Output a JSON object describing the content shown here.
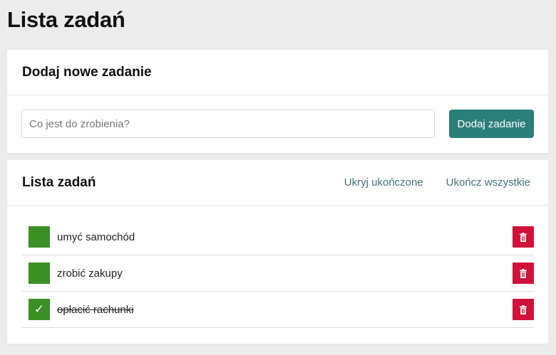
{
  "page": {
    "title": "Lista zadań"
  },
  "add_section": {
    "heading": "Dodaj nowe zadanie",
    "input_placeholder": "Co jest do zrobienia?",
    "input_value": "",
    "button_label": "Dodaj zadanie"
  },
  "list_section": {
    "heading": "Lista zadań",
    "hide_completed_label": "Ukryj ukończone",
    "complete_all_label": "Ukończ wszystkie",
    "tasks": [
      {
        "text": "umyć samochód",
        "completed": false,
        "check_glyph": ""
      },
      {
        "text": "zrobić zakupy",
        "completed": false,
        "check_glyph": ""
      },
      {
        "text": "opłacić rachunki",
        "completed": true,
        "check_glyph": "✓"
      }
    ]
  },
  "colors": {
    "accent": "#2b7f7b",
    "checkbox_green": "#3a8f25",
    "delete_red": "#d0113a",
    "link": "#3f7477"
  },
  "icons": {
    "delete": "trash-icon",
    "check": "checkmark-icon"
  }
}
